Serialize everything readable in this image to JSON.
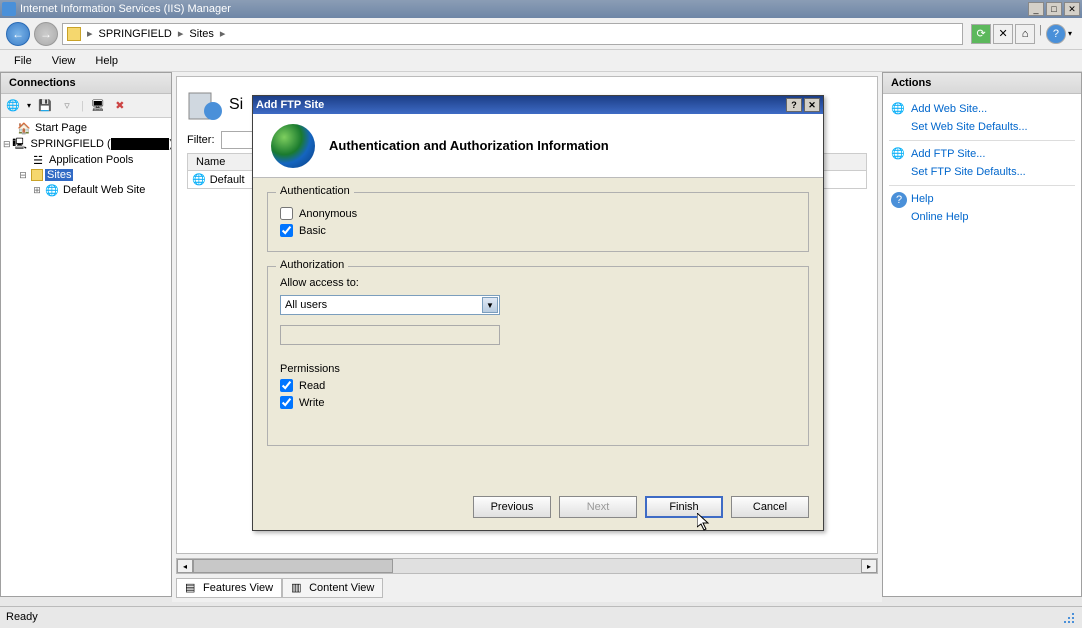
{
  "window": {
    "title": "Internet Information Services (IIS) Manager"
  },
  "breadcrumb": {
    "server": "SPRINGFIELD",
    "node": "Sites"
  },
  "menu": {
    "file": "File",
    "view": "View",
    "help": "Help"
  },
  "connections": {
    "header": "Connections",
    "tree": {
      "start_page": "Start Page",
      "server": "SPRINGFIELD (",
      "app_pools": "Application Pools",
      "sites": "Sites",
      "default_site": "Default Web Site"
    }
  },
  "center": {
    "page_title_prefix": "Si",
    "filter_label": "Filter:",
    "columns": {
      "name": "Name"
    },
    "rows": {
      "default": "Default"
    }
  },
  "view_tabs": {
    "features": "Features View",
    "content": "Content View"
  },
  "actions": {
    "header": "Actions",
    "add_web_site": "Add Web Site...",
    "set_web_defaults": "Set Web Site Defaults...",
    "add_ftp_site": "Add FTP Site...",
    "set_ftp_defaults": "Set FTP Site Defaults...",
    "help": "Help",
    "online_help": "Online Help"
  },
  "dialog": {
    "title": "Add FTP Site",
    "banner": "Authentication and Authorization Information",
    "auth_group": "Authentication",
    "anonymous": "Anonymous",
    "basic": "Basic",
    "authz_group": "Authorization",
    "allow_access": "Allow access to:",
    "access_value": "All users",
    "permissions": "Permissions",
    "read": "Read",
    "write": "Write",
    "buttons": {
      "previous": "Previous",
      "next": "Next",
      "finish": "Finish",
      "cancel": "Cancel"
    }
  },
  "status": {
    "ready": "Ready"
  }
}
